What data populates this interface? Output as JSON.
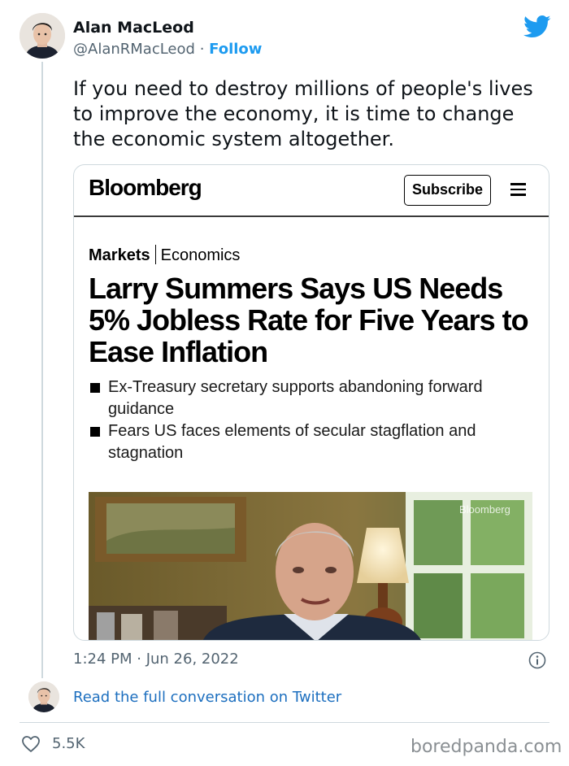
{
  "author": {
    "display_name": "Alan MacLeod",
    "handle": "@AlanRMacLeod",
    "separator": "·",
    "follow_label": "Follow"
  },
  "brand_icon": "twitter-bird-icon",
  "tweet_text": "If you need to destroy millions of people's lives to improve the economy, it is time to change the economic system altogether.",
  "embedded_article": {
    "logo": "Bloomberg",
    "subscribe_label": "Subscribe",
    "menu_icon": "hamburger-menu-icon",
    "section": "Markets",
    "subsection": "Economics",
    "headline": "Larry Summers Says US Needs 5% Jobless Rate for Five Years to Ease Inflation",
    "bullets": [
      "Ex-Treasury secretary supports abandoning forward guidance",
      "Fears US faces elements of secular stagflation and stagnation"
    ],
    "photo_watermark": "Bloomberg"
  },
  "timestamp": "1:24 PM · Jun 26, 2022",
  "info_icon": "info-icon",
  "read_conversation_label": "Read the full conversation on Twitter",
  "likes": {
    "icon": "heart-icon",
    "count": "5.5K"
  },
  "site_watermark": "boredpanda.com",
  "colors": {
    "twitter_blue": "#1d9bf0",
    "link_blue": "#1d6fbf",
    "muted_text": "#536471",
    "border": "#cfd9de"
  }
}
